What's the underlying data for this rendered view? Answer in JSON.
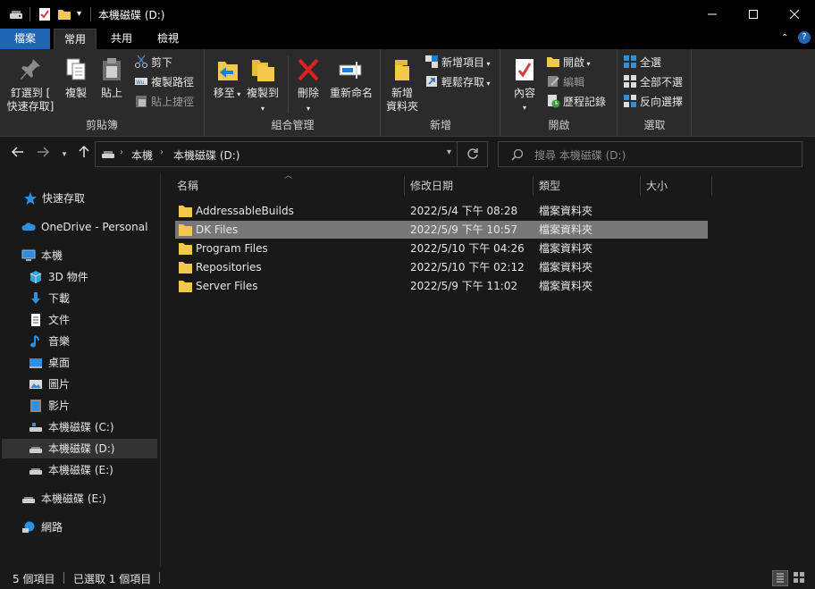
{
  "titlebar": {
    "title": "本機磁碟 (D:)",
    "minimize_icon": "minimize-icon",
    "maximize_icon": "maximize-icon",
    "close_icon": "close-icon"
  },
  "tabs": [
    "檔案",
    "常用",
    "共用",
    "檢視"
  ],
  "ribbon": {
    "clipboard": {
      "label": "剪貼簿",
      "pin": "釘選到 [快速存取]",
      "pin_line1": "釘選到 [",
      "pin_line2": "快速存取]",
      "copy": "複製",
      "paste": "貼上",
      "cut": "剪下",
      "copy_path": "複製路徑",
      "paste_shortcut": "貼上捷徑"
    },
    "organize": {
      "label": "組合管理",
      "move_to": "移至",
      "copy_to": "複製到",
      "delete": "刪除",
      "rename": "重新命名"
    },
    "new": {
      "label": "新增",
      "new_folder_line1": "新增",
      "new_folder_line2": "資料夾",
      "new_item": "新增項目",
      "easy_access": "輕鬆存取"
    },
    "open": {
      "label": "開啟",
      "properties": "內容",
      "open": "開啟",
      "edit": "編輯",
      "history": "歷程記錄"
    },
    "select": {
      "label": "選取",
      "select_all": "全選",
      "select_none": "全部不選",
      "invert": "反向選擇"
    }
  },
  "address": {
    "crumbs": [
      "本機",
      "本機磁碟 (D:)"
    ],
    "search_placeholder": "搜尋 本機磁碟 (D:)"
  },
  "navpane": {
    "items": [
      {
        "label": "快速存取",
        "icon": "star-icon"
      },
      {
        "label": "OneDrive - Personal",
        "icon": "cloud-icon"
      },
      {
        "label": "本機",
        "icon": "computer-icon"
      },
      {
        "label": "3D 物件",
        "icon": "cube-icon"
      },
      {
        "label": "下載",
        "icon": "download-icon"
      },
      {
        "label": "文件",
        "icon": "document-icon"
      },
      {
        "label": "音樂",
        "icon": "music-icon"
      },
      {
        "label": "桌面",
        "icon": "desktop-icon"
      },
      {
        "label": "圖片",
        "icon": "picture-icon"
      },
      {
        "label": "影片",
        "icon": "video-icon"
      },
      {
        "label": "本機磁碟 (C:)",
        "icon": "drive-icon"
      },
      {
        "label": "本機磁碟 (D:)",
        "icon": "drive-icon"
      },
      {
        "label": "本機磁碟 (E:)",
        "icon": "drive-icon"
      },
      {
        "label": "本機磁碟 (E:)",
        "icon": "drive-icon"
      },
      {
        "label": "網路",
        "icon": "network-icon"
      }
    ]
  },
  "columns": [
    "名稱",
    "修改日期",
    "類型",
    "大小"
  ],
  "files": [
    {
      "name": "AddressableBuilds",
      "date": "2022/5/4 下午 08:28",
      "type": "檔案資料夾",
      "size": ""
    },
    {
      "name": "DK Files",
      "date": "2022/5/9 下午 10:57",
      "type": "檔案資料夾",
      "size": ""
    },
    {
      "name": "Program Files",
      "date": "2022/5/10 下午 04:26",
      "type": "檔案資料夾",
      "size": ""
    },
    {
      "name": "Repositories",
      "date": "2022/5/10 下午 02:12",
      "type": "檔案資料夾",
      "size": ""
    },
    {
      "name": "Server Files",
      "date": "2022/5/9 下午 11:02",
      "type": "檔案資料夾",
      "size": ""
    }
  ],
  "status": {
    "count": "5 個項目",
    "selected": "已選取 1 個項目"
  },
  "colors": {
    "accent": "#1f65b3",
    "folder": "#f4c84a",
    "selected_row": "#777777"
  }
}
